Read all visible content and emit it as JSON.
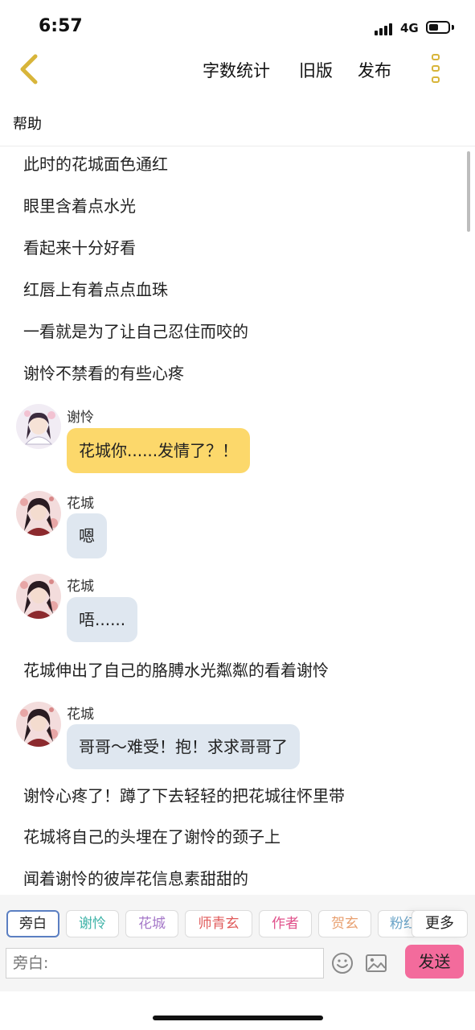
{
  "status_bar": {
    "time": "6:57",
    "network": "4G"
  },
  "nav": {
    "word_count": "字数统计",
    "old_version": "旧版",
    "publish": "发布"
  },
  "help": "帮助",
  "content": {
    "narration_top": [
      "此时的花城面色通红",
      "眼里含着点水光",
      "看起来十分好看",
      "红唇上有着点点血珠",
      "一看就是为了让自己忍住而咬的",
      "谢怜不禁看的有些心疼"
    ],
    "dialogs": [
      {
        "speaker": "谢怜",
        "text": "花城你......发情了？！",
        "color": "#fcd86b"
      },
      {
        "speaker": "花城",
        "text": "嗯",
        "color": "#dfe7f0"
      },
      {
        "speaker": "花城",
        "text": "唔......",
        "color": "#dfe7f0"
      },
      {
        "speaker": "花城",
        "text": "哥哥～难受！抱！求求哥哥了",
        "color": "#dfe7f0"
      }
    ],
    "narration_mid": "花城伸出了自己的胳膊水光粼粼的看着谢怜",
    "narration_bottom": [
      "谢怜心疼了！蹲了下去轻轻的把花城往怀里带",
      "花城将自己的头埋在了谢怜的颈子上",
      "闻着谢怜的彼岸花信息素甜甜的"
    ]
  },
  "roles": [
    {
      "label": "旁白",
      "color": "#222222"
    },
    {
      "label": "谢怜",
      "color": "#3fb3a8"
    },
    {
      "label": "花城",
      "color": "#a679c9"
    },
    {
      "label": "师青玄",
      "color": "#e05a5a"
    },
    {
      "label": "作者",
      "color": "#e0508a"
    },
    {
      "label": "贺玄",
      "color": "#e8a070"
    },
    {
      "label": "粉红",
      "color": "#6aa4c8"
    }
  ],
  "more_label": "更多",
  "input": {
    "placeholder": "旁白:"
  },
  "send_label": "发送",
  "icons": {
    "back": "chevron-left-icon",
    "menu": "more-vertical-icon",
    "emoji": "emoji-icon",
    "image": "image-icon"
  }
}
